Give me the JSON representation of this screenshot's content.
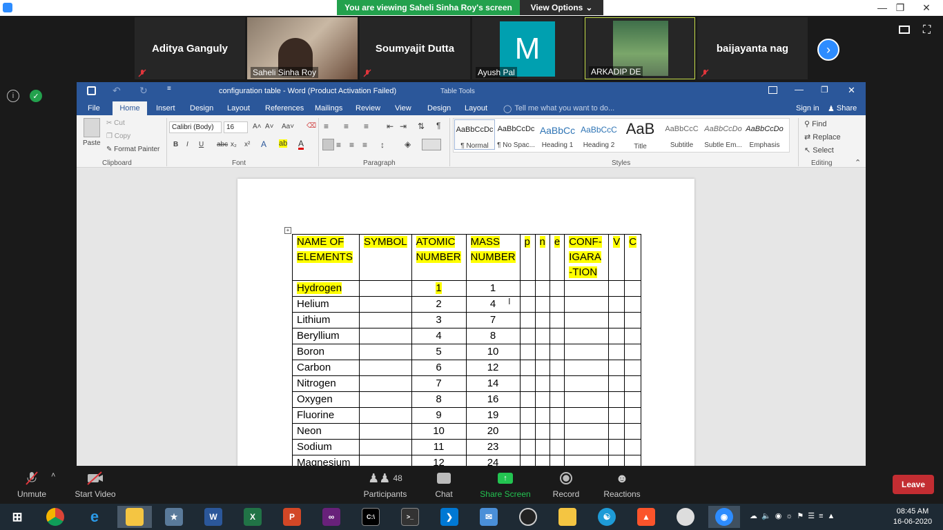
{
  "zoom": {
    "banner": "You are viewing Saheli Sinha Roy's screen",
    "view_options": "View Options",
    "participants": [
      {
        "name": "Aditya Ganguly"
      },
      {
        "name": "Saheli Sinha Roy"
      },
      {
        "name": "Soumyajit Dutta"
      },
      {
        "name": "Ayush Pal",
        "initial": "M"
      },
      {
        "name": "ARKADIP DE"
      },
      {
        "name": "baijayanta nag"
      }
    ],
    "controls": {
      "unmute": "Unmute",
      "start_video": "Start Video",
      "participants": "Participants",
      "participants_count": "48",
      "chat": "Chat",
      "share_screen": "Share Screen",
      "record": "Record",
      "reactions": "Reactions",
      "leave": "Leave"
    }
  },
  "word": {
    "title": "configuration table - Word (Product Activation Failed)",
    "table_tools": "Table Tools",
    "tabs": [
      "File",
      "Home",
      "Insert",
      "Design",
      "Layout",
      "References",
      "Mailings",
      "Review",
      "View",
      "Design",
      "Layout"
    ],
    "tell_me": "Tell me what you want to do...",
    "sign_in": "Sign in",
    "share": "Share",
    "clipboard": {
      "paste": "Paste",
      "cut": "Cut",
      "copy": "Copy",
      "format_painter": "Format Painter",
      "label": "Clipboard"
    },
    "font": {
      "name": "Calibri (Body)",
      "size": "16",
      "label": "Font"
    },
    "paragraph_label": "Paragraph",
    "styles": [
      {
        "preview": "AaBbCcDc",
        "name": "¶ Normal"
      },
      {
        "preview": "AaBbCcDc",
        "name": "¶ No Spac..."
      },
      {
        "preview": "AaBbCc",
        "name": "Heading 1"
      },
      {
        "preview": "AaBbCcC",
        "name": "Heading 2"
      },
      {
        "preview": "AaB",
        "name": "Title"
      },
      {
        "preview": "AaBbCcC",
        "name": "Subtitle"
      },
      {
        "preview": "AaBbCcDo",
        "name": "Subtle Em..."
      },
      {
        "preview": "AaBbCcDo",
        "name": "Emphasis"
      }
    ],
    "styles_label": "Styles",
    "editing": {
      "find": "Find",
      "replace": "Replace",
      "select": "Select",
      "label": "Editing"
    },
    "table": {
      "headers": [
        "NAME OF ELEMENTS",
        "SYMBOL",
        "ATOMIC NUMBER",
        "MASS NUMBER",
        "p",
        "n",
        "e",
        "CONF-IGARA-TION",
        "V",
        "C"
      ],
      "rows": [
        [
          "Hydrogen",
          "",
          "1",
          "1"
        ],
        [
          "Helium",
          "",
          "2",
          "4"
        ],
        [
          "Lithium",
          "",
          "3",
          "7"
        ],
        [
          "Beryllium",
          "",
          "4",
          "8"
        ],
        [
          "Boron",
          "",
          "5",
          "10"
        ],
        [
          "Carbon",
          "",
          "6",
          "12"
        ],
        [
          "Nitrogen",
          "",
          "7",
          "14"
        ],
        [
          "Oxygen",
          "",
          "8",
          "16"
        ],
        [
          "Fluorine",
          "",
          "9",
          "19"
        ],
        [
          "Neon",
          "",
          "10",
          "20"
        ],
        [
          "Sodium",
          "",
          "11",
          "23"
        ],
        [
          "Magnesium",
          "",
          "12",
          "24"
        ]
      ]
    }
  },
  "taskbar": {
    "time": "08:45 AM",
    "date": "16-06-2020"
  }
}
